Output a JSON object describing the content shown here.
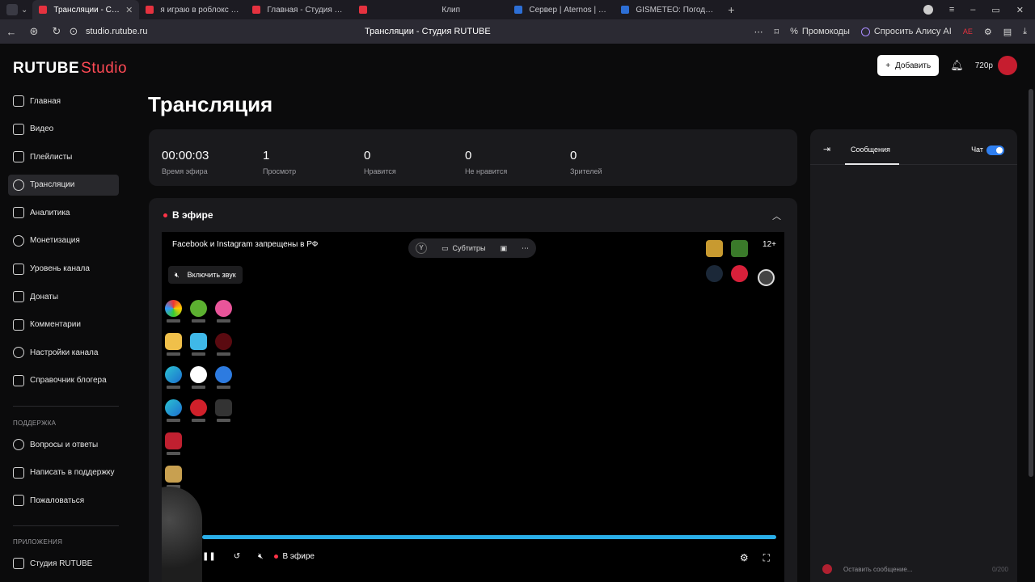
{
  "browser": {
    "tabs": [
      {
        "label": "Трансляции - Студия",
        "color": "#e5323f",
        "active": true
      },
      {
        "label": "я играю в роблокс на VK",
        "color": "#e5323f",
        "active": false
      },
      {
        "label": "Главная - Студия RUTUBE",
        "color": "#e5323f",
        "active": false
      },
      {
        "label": "",
        "color": "#e5323f",
        "active": false
      },
      {
        "label": "Клип",
        "color": "#3a3a44",
        "active": false
      },
      {
        "label": "Сервер | Aternos | Беспл",
        "color": "#2d6fd6",
        "active": false
      },
      {
        "label": "GISMETEO: Погода в Ти",
        "color": "#2d6fd6",
        "active": false
      }
    ],
    "url": "studio.rutube.ru",
    "page_title": "Трансляции - Студия RUTUBE",
    "promo": "Промокоды",
    "alice": "Спросить Алису AI"
  },
  "app": {
    "logo_main": "RUTUBE",
    "logo_sub": "Studio",
    "header": {
      "add_label": "Добавить",
      "balance": "720р"
    },
    "sidebar": {
      "items": [
        {
          "label": "Главная"
        },
        {
          "label": "Видео"
        },
        {
          "label": "Плейлисты"
        },
        {
          "label": "Трансляции"
        },
        {
          "label": "Аналитика"
        },
        {
          "label": "Монетизация"
        },
        {
          "label": "Уровень канала"
        },
        {
          "label": "Донаты"
        },
        {
          "label": "Комментарии"
        },
        {
          "label": "Настройки канала"
        },
        {
          "label": "Справочник блогера"
        }
      ],
      "support_title": "ПОДДЕРЖКА",
      "support": [
        {
          "label": "Вопросы и ответы"
        },
        {
          "label": "Написать в поддержку"
        },
        {
          "label": "Пожаловаться"
        }
      ],
      "apps_title": "ПРИЛОЖЕНИЯ",
      "apps": [
        {
          "label": "Студия RUTUBE"
        }
      ]
    },
    "page_title": "Трансляция",
    "stats": [
      {
        "value": "00:00:03",
        "label": "Время эфира"
      },
      {
        "value": "1",
        "label": "Просмотр"
      },
      {
        "value": "0",
        "label": "Нравится"
      },
      {
        "value": "0",
        "label": "Не нравится"
      },
      {
        "value": "0",
        "label": "Зрителей"
      }
    ],
    "live_title": "В эфире",
    "player": {
      "notice": "Facebook и Instagram запрещены в РФ",
      "unmute": "Включить звук",
      "subtitles": "Субтитры",
      "age": "12+",
      "live_label": "В эфире",
      "progress": 1.0
    },
    "chat": {
      "messages_tab": "Сообщения",
      "chat_label": "Чат",
      "chat_enabled": true,
      "input_placeholder": "Оставить сообщение...",
      "counter": "0/200"
    }
  }
}
